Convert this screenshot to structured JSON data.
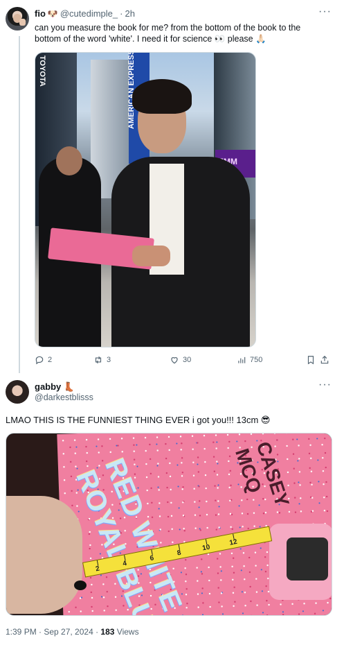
{
  "tweet1": {
    "display_name": "fio",
    "name_emoji": "🐶",
    "handle": "@cutedimple_",
    "separator": "·",
    "time": "2h",
    "text": "can you measure the book for me? from the bottom of the book to the bottom of the word 'white'. I need it for science 👀 please 🙏🏻",
    "photo_banner_text": "AMERICAN EXPRESS",
    "photo_emmy_text": "EMM",
    "photo_left_sign": "TOYOTA",
    "actions": {
      "replies": "2",
      "retweets": "3",
      "likes": "30",
      "views": "750"
    }
  },
  "tweet2": {
    "display_name": "gabby",
    "name_emoji": "👢",
    "handle": "@darkestblisss",
    "text": "LMAO THIS IS THE FUNNIEST THING EVER i got you!!! 13cm 😎",
    "book_title": "RED WHITE ROYAL BLUE",
    "book_author": "CASEY MCQ",
    "timestamp": "1:39 PM · Sep 27, 2024 · ",
    "views_count": "183",
    "views_label": " Views"
  },
  "ui": {
    "more_glyph": "···",
    "link_color": "#1d9bf0",
    "muted_color": "#536471",
    "text_color": "#0f1419"
  }
}
